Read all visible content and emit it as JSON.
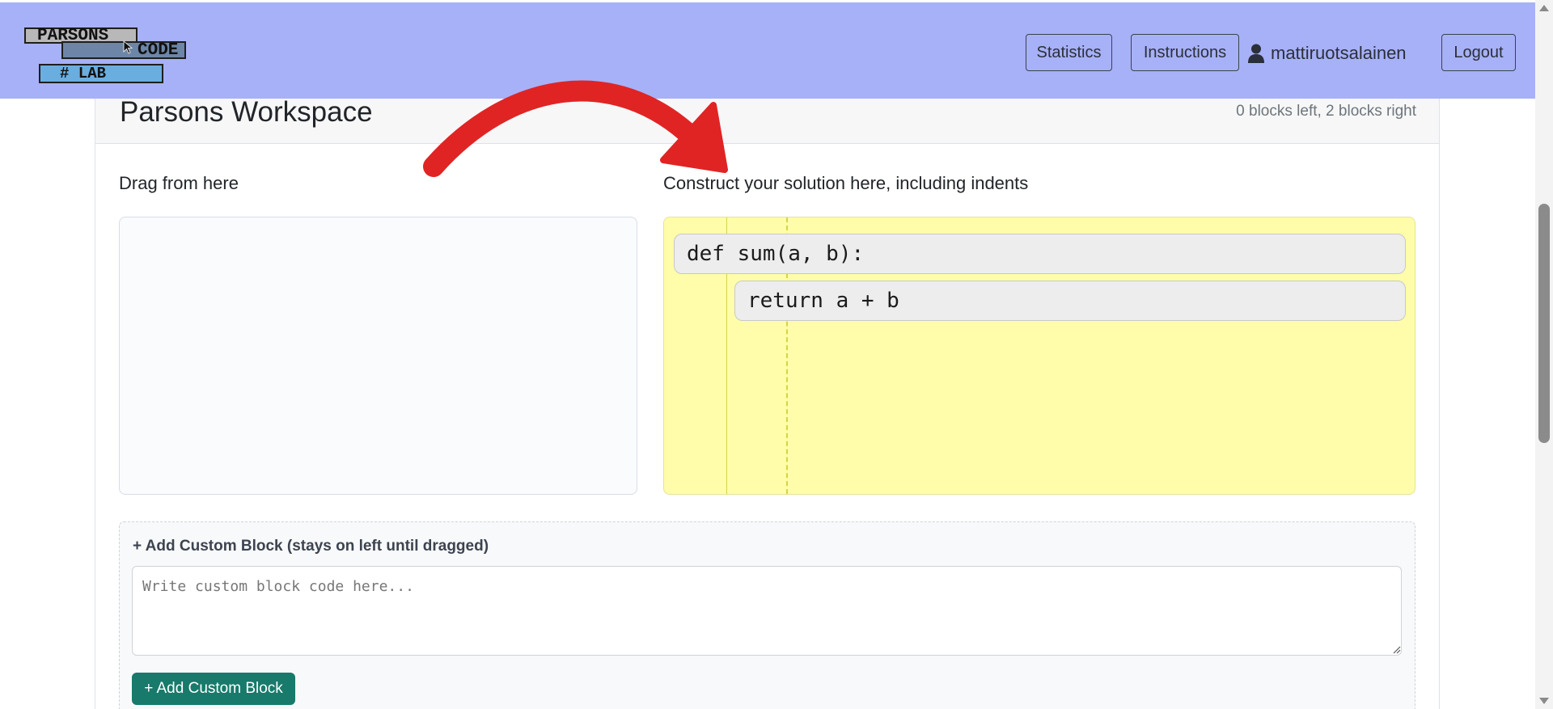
{
  "app": {
    "logo_text": [
      "PARSONS",
      "CODE",
      "# LAB"
    ]
  },
  "nav": {
    "statistics_label": "Statistics",
    "instructions_label": "Instructions",
    "username": "mattiruotsalainen",
    "logout_label": "Logout"
  },
  "workspace": {
    "title": "Parsons Workspace",
    "block_count": "0 blocks left, 2 blocks right",
    "drag_label": "Drag from here",
    "solution_label": "Construct your solution here, including indents",
    "solution_blocks": [
      {
        "code": "def sum(a, b):",
        "indent": 0
      },
      {
        "code": "return a + b",
        "indent": 1
      }
    ]
  },
  "custom_block": {
    "title": "+ Add Custom Block (stays on left until dragged)",
    "placeholder": "Write custom block code here...",
    "button_label": "+ Add Custom Block"
  },
  "colors": {
    "navbar": "#a7b1f7",
    "solution_area": "#fffda9",
    "add_button": "#177a6b",
    "annotation_arrow": "#e02424"
  },
  "icons": {
    "user": "user-icon",
    "arrow": "curved-arrow-icon",
    "logo_cursor": "cursor-icon"
  }
}
